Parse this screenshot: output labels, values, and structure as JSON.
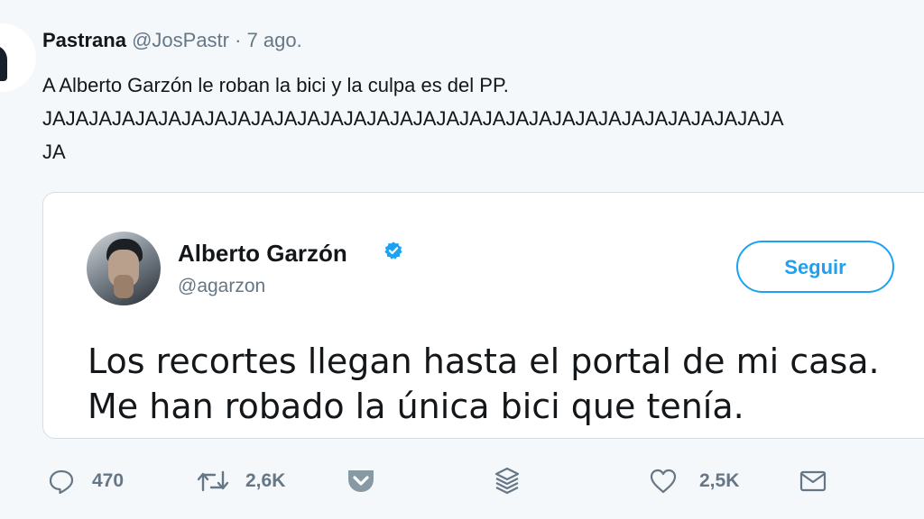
{
  "tweet": {
    "author_name": "Pastrana",
    "author_handle": "@JosPastr",
    "separator": "·",
    "date": "7 ago.",
    "text_lines": [
      "A Alberto Garzón le roban la bici y la culpa es del PP.",
      "JAJAJAJAJAJAJAJAJAJAJAJAJAJAJAJAJAJAJAJAJAJAJAJAJAJAJAJAJAJAJAJA",
      "JA"
    ]
  },
  "quoted_tweet": {
    "author_name": "Alberto Garzón",
    "author_handle": "@agarzon",
    "follow_label": "Seguir",
    "text_lines": [
      "Los recortes llegan hasta el portal de mi casa.",
      "Me han robado la única bici que tenía."
    ]
  },
  "actions": {
    "reply_count": "470",
    "retweet_count": "2,6K",
    "like_count": "2,5K"
  },
  "colors": {
    "accent": "#1da1f2",
    "muted": "#657786",
    "background": "#f5f8fa"
  },
  "icons": [
    "reply-icon",
    "retweet-icon",
    "pocket-icon",
    "stack-icon",
    "heart-icon",
    "envelope-icon",
    "verified-icon"
  ]
}
